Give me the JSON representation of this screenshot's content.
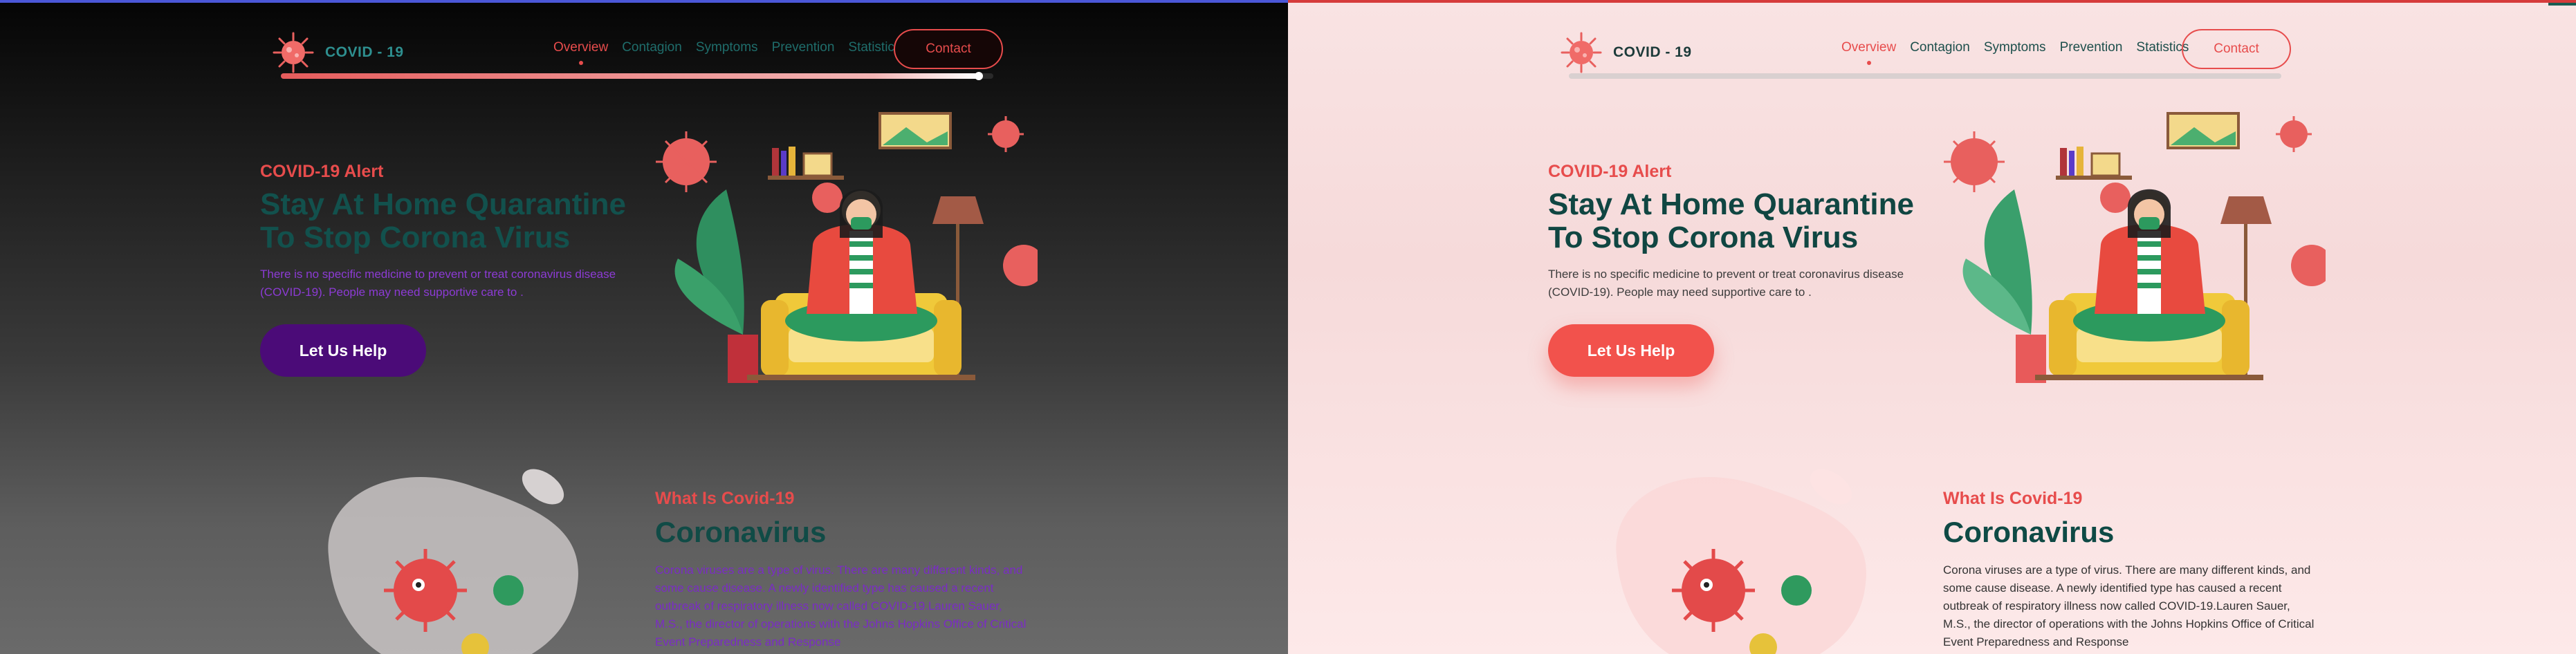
{
  "brand": {
    "name": "COVID - 19"
  },
  "nav": {
    "items": [
      {
        "label": "Overview",
        "active": true
      },
      {
        "label": "Contagion"
      },
      {
        "label": "Symptoms"
      },
      {
        "label": "Prevention"
      },
      {
        "label": "Statistics"
      }
    ],
    "contact_label": "Contact"
  },
  "scroll_progress": {
    "dark": 0.98,
    "light": 0
  },
  "hero": {
    "eyebrow": "COVID-19 Alert",
    "title": "Stay At Home Quarantine To Stop Corona Virus",
    "description": "There is no specific medicine to prevent or treat coronavirus disease (COVID-19). People may need supportive care to .",
    "cta_label": "Let Us Help"
  },
  "about": {
    "eyebrow": "What Is Covid-19",
    "title": "Coronavirus",
    "body": "Corona viruses are a type of virus. There are many different kinds, and some cause disease. A newly identified type has caused a recent outbreak of respiratory illness now called COVID-19.Lauren Sauer, M.S., the director of operations with the Johns Hopkins Office of Critical Event Preparedness and Response"
  },
  "colors": {
    "accent": "#e74c4c",
    "heading_teal": "#104642",
    "dark_cta": "#4b0b78",
    "light_cta": "#f2524c"
  },
  "icons": [
    "virus-logo-icon",
    "virus-icon"
  ]
}
